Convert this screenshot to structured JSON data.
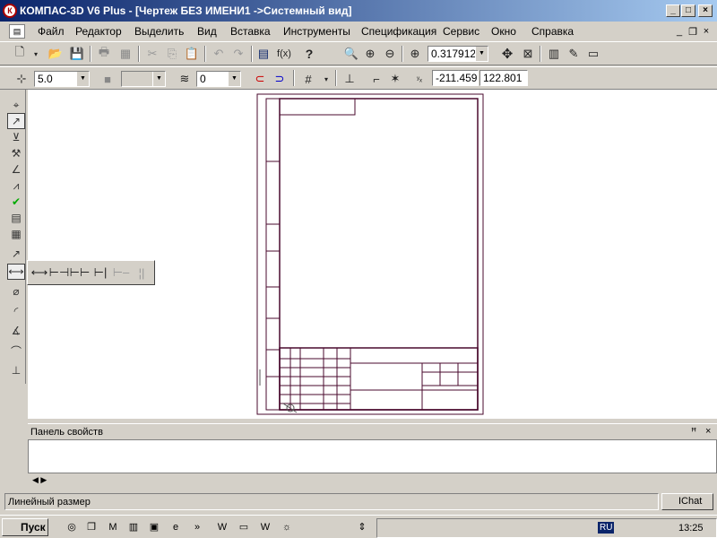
{
  "window": {
    "title": "КОМПАС-3D V6 Plus - [Чертеж БЕЗ ИМЕНИ1 ->Системный вид]"
  },
  "menu": [
    "Файл",
    "Редактор",
    "Выделить",
    "Вид",
    "Вставка",
    "Инструменты",
    "Спецификация",
    "Сервис",
    "Окно",
    "Справка"
  ],
  "toolbar1": {
    "zoom_value": "0.317912"
  },
  "toolbar2": {
    "step_value": "5.0",
    "layer_value": "0",
    "coord_x": "-211.459",
    "coord_y": "122.801"
  },
  "panels": {
    "properties_title": "Панель свойств"
  },
  "status": {
    "text": "Линейный размер",
    "chat_label": "IChat"
  },
  "taskbar": {
    "start_label": "Пуск",
    "clock": "13:25",
    "lang": "RU"
  },
  "colors": {
    "drawing_frame": "#4a0a2e",
    "title_bar": "#0a246a"
  }
}
